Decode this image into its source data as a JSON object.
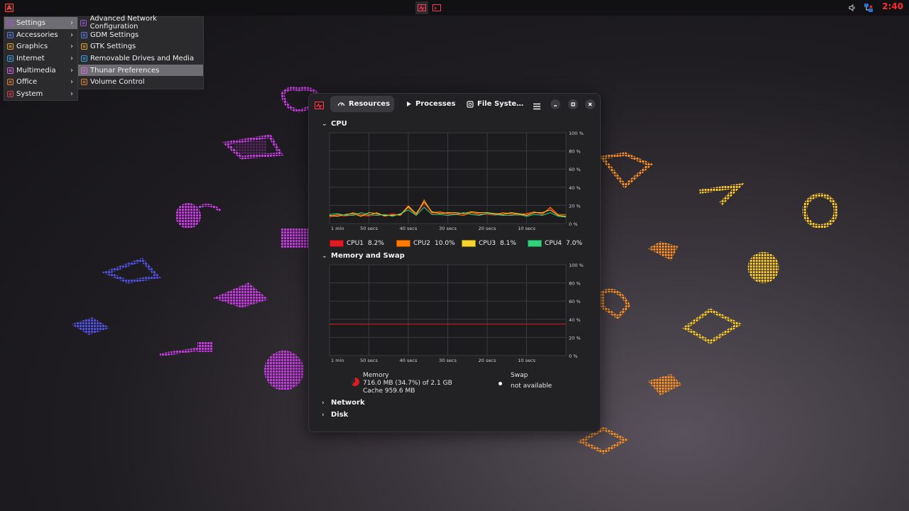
{
  "top_panel": {
    "clock": "2:40",
    "accent": "#ff2a2a"
  },
  "menu": {
    "items": [
      {
        "label": "Settings",
        "icon": "settings-icon",
        "selected": true
      },
      {
        "label": "Accessories",
        "icon": "accessories-icon"
      },
      {
        "label": "Graphics",
        "icon": "graphics-icon"
      },
      {
        "label": "Internet",
        "icon": "internet-icon"
      },
      {
        "label": "Multimedia",
        "icon": "multimedia-icon"
      },
      {
        "label": "Office",
        "icon": "office-icon"
      },
      {
        "label": "System",
        "icon": "system-icon"
      }
    ]
  },
  "submenu": {
    "items": [
      {
        "label": "Advanced Network Configuration",
        "icon": "network-config-icon"
      },
      {
        "label": "GDM Settings",
        "icon": "gdm-icon"
      },
      {
        "label": "GTK Settings",
        "icon": "gtk-icon"
      },
      {
        "label": "Removable Drives and Media",
        "icon": "drive-icon"
      },
      {
        "label": "Thunar Preferences",
        "icon": "thunar-icon",
        "selected": true
      },
      {
        "label": "Volume Control",
        "icon": "volume-icon"
      }
    ]
  },
  "window": {
    "tabs": [
      {
        "label": "Resources",
        "icon": "gauge-icon",
        "active": true
      },
      {
        "label": "Processes",
        "icon": "play-icon"
      },
      {
        "label": "File Syste…",
        "icon": "disk-icon"
      }
    ],
    "sections": {
      "cpu": "CPU",
      "memory": "Memory and Swap",
      "network": "Network",
      "disk": "Disk"
    },
    "memory": {
      "title": "Memory",
      "usage": "716.0 MB (34.7%) of 2.1 GB",
      "cache": "Cache 959.6 MB",
      "swap_title": "Swap",
      "swap_value": "not available",
      "memory_color": "#e01b24",
      "percent": 34.7
    }
  },
  "chart_data": [
    {
      "type": "line",
      "title": "CPU",
      "x_tick_labels": [
        "1 min",
        "50 secs",
        "40 secs",
        "30 secs",
        "20 secs",
        "10 secs"
      ],
      "y_tick_labels": [
        "100 %",
        "80 %",
        "60 %",
        "40 %",
        "20 %",
        "0 %"
      ],
      "ylim": [
        0,
        100
      ],
      "grid": true,
      "x": [
        60,
        58,
        56,
        54,
        52,
        50,
        48,
        46,
        44,
        42,
        40,
        38,
        36,
        34,
        32,
        30,
        28,
        26,
        24,
        22,
        20,
        18,
        16,
        14,
        12,
        10,
        8,
        6,
        4,
        2,
        0
      ],
      "series": [
        {
          "name": "CPU1",
          "value_label": "8.2%",
          "color": "#e01b24",
          "values": [
            7,
            9,
            8,
            10,
            9,
            8,
            10,
            9,
            11,
            9,
            20,
            10,
            22,
            11,
            12,
            10,
            11,
            10,
            12,
            11,
            10,
            9,
            11,
            10,
            9,
            10,
            12,
            11,
            17,
            9,
            8
          ]
        },
        {
          "name": "CPU2",
          "value_label": "10.0%",
          "color": "#ff7800",
          "values": [
            8,
            10,
            9,
            12,
            10,
            9,
            12,
            8,
            10,
            9,
            18,
            9,
            26,
            12,
            13,
            11,
            10,
            9,
            12,
            10,
            11,
            10,
            12,
            11,
            10,
            11,
            13,
            10,
            18,
            10,
            10
          ]
        },
        {
          "name": "CPU3",
          "value_label": "8.1%",
          "color": "#f6d32d",
          "values": [
            9,
            8,
            10,
            11,
            8,
            12,
            11,
            9,
            9,
            10,
            19,
            11,
            24,
            13,
            11,
            12,
            12,
            11,
            13,
            12,
            12,
            11,
            10,
            12,
            11,
            9,
            12,
            12,
            15,
            9,
            8
          ]
        },
        {
          "name": "CPU4",
          "value_label": "7.0%",
          "color": "#33d17a",
          "values": [
            10,
            11,
            9,
            9,
            12,
            10,
            9,
            10,
            8,
            11,
            15,
            9,
            18,
            10,
            10,
            9,
            10,
            12,
            10,
            9,
            11,
            10,
            9,
            9,
            10,
            8,
            10,
            9,
            12,
            8,
            7
          ]
        }
      ],
      "legend": "bottom"
    },
    {
      "type": "line",
      "title": "Memory and Swap",
      "x_tick_labels": [
        "1 min",
        "50 secs",
        "40 secs",
        "30 secs",
        "20 secs",
        "10 secs"
      ],
      "y_tick_labels": [
        "100 %",
        "80 %",
        "60 %",
        "40 %",
        "20 %",
        "0 %"
      ],
      "ylim": [
        0,
        100
      ],
      "grid": true,
      "x": [
        60,
        0
      ],
      "series": [
        {
          "name": "Memory",
          "color": "#e01b24",
          "values": [
            34.7,
            34.7
          ]
        }
      ]
    }
  ]
}
